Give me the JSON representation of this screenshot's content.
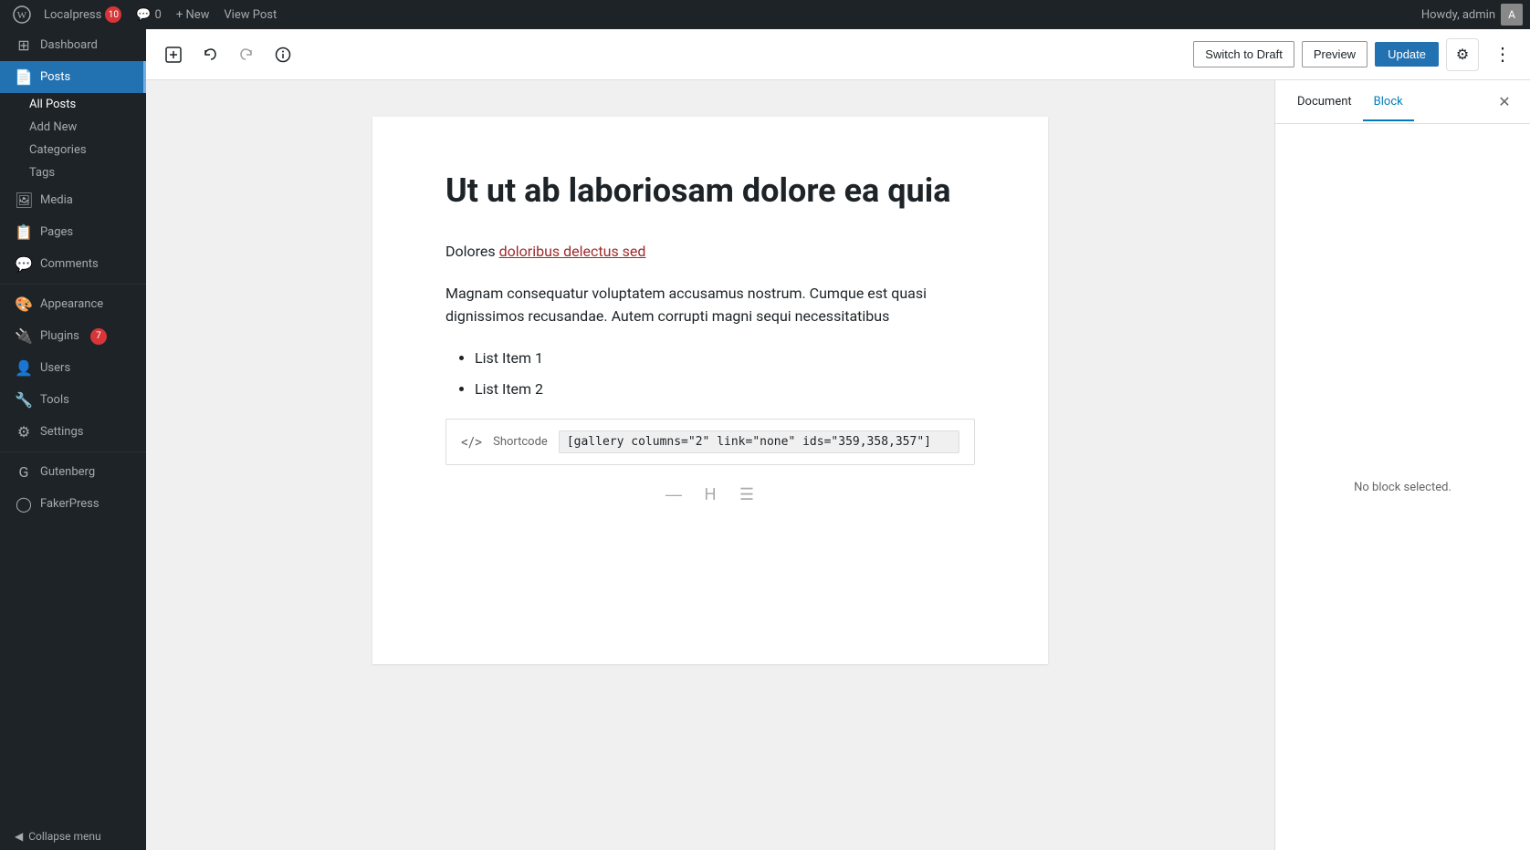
{
  "adminbar": {
    "logo": "⊞",
    "site_name": "Localpress",
    "updates_count": "10",
    "comments_icon": "💬",
    "comments_count": "0",
    "new_label": "+ New",
    "view_post_label": "View Post",
    "howdy": "Howdy, admin"
  },
  "sidebar": {
    "dashboard_label": "Dashboard",
    "posts_label": "Posts",
    "all_posts_label": "All Posts",
    "add_new_label": "Add New",
    "categories_label": "Categories",
    "tags_label": "Tags",
    "media_label": "Media",
    "pages_label": "Pages",
    "comments_label": "Comments",
    "appearance_label": "Appearance",
    "plugins_label": "Plugins",
    "plugins_badge": "7",
    "users_label": "Users",
    "tools_label": "Tools",
    "settings_label": "Settings",
    "gutenberg_label": "Gutenberg",
    "fakerpress_label": "FakerPress",
    "collapse_label": "Collapse menu"
  },
  "toolbar": {
    "switch_draft_label": "Switch to Draft",
    "preview_label": "Preview",
    "update_label": "Update"
  },
  "panels": {
    "document_tab": "Document",
    "block_tab": "Block",
    "no_block_selected": "No block selected."
  },
  "post": {
    "title": "Ut ut ab laboriosam dolore ea quia",
    "paragraph1_start": "Dolores ",
    "paragraph1_link": "doloribus delectus sed",
    "paragraph2": "Magnam consequatur voluptatem accusamus nostrum. Cumque est quasi dignissimos recusandae. Autem corrupti magni sequi necessitatibus",
    "list_items": [
      "List Item 1",
      "List Item 2"
    ],
    "shortcode_label": "Shortcode",
    "shortcode_value": "[gallery columns=\"2\" link=\"none\" ids=\"359,358,357\"]"
  }
}
